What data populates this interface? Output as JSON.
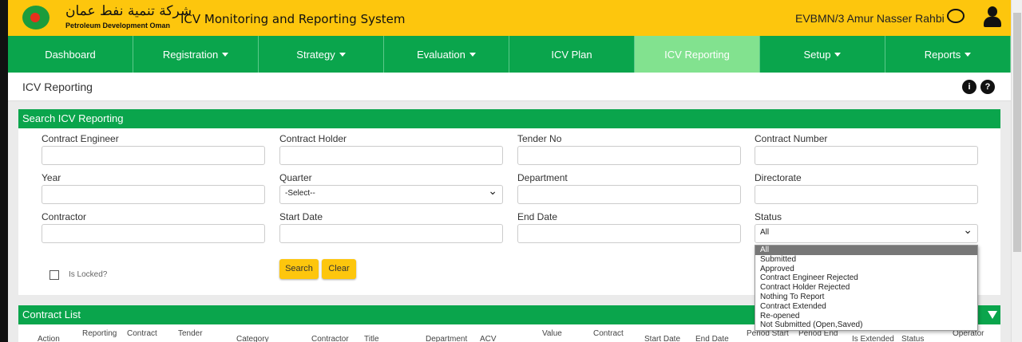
{
  "header": {
    "logo_arabic": "شركة تنمية نفط عمان",
    "logo_text": "Petroleum Development Oman",
    "title": "ICV Monitoring and Reporting System",
    "user": "EVBMN/3 Amur Nasser Rahbi"
  },
  "nav": [
    {
      "label": "Dashboard",
      "caret": false
    },
    {
      "label": "Registration",
      "caret": true
    },
    {
      "label": "Strategy",
      "caret": true
    },
    {
      "label": "Evaluation",
      "caret": true
    },
    {
      "label": "ICV Plan",
      "caret": false
    },
    {
      "label": "ICV Reporting",
      "caret": false,
      "active": true
    },
    {
      "label": "Setup",
      "caret": true
    },
    {
      "label": "Reports",
      "caret": true
    }
  ],
  "page": {
    "title": "ICV Reporting",
    "info_icon": "i",
    "help_icon": "?"
  },
  "search": {
    "title": "Search ICV Reporting",
    "fields": {
      "contract_engineer": "Contract Engineer",
      "contract_holder": "Contract Holder",
      "tender_no": "Tender No",
      "contract_number": "Contract Number",
      "year": "Year",
      "quarter": "Quarter",
      "department": "Department",
      "directorate": "Directorate",
      "contractor": "Contractor",
      "start_date": "Start Date",
      "end_date": "End Date",
      "status": "Status"
    },
    "quarter_value": "-Select--",
    "status_value": "All",
    "is_locked": "Is Locked?",
    "search_btn": "Search",
    "clear_btn": "Clear",
    "status_options": [
      "All",
      "Submitted",
      "Approved",
      "Contract Engineer Rejected",
      "Contract Holder Rejected",
      "Nothing To Report",
      "Contract Extended",
      "Re-opened",
      "Not Submitted (Open,Saved)"
    ]
  },
  "contract_list": {
    "title": "Contract List",
    "columns": [
      "Action",
      "Reporting",
      "Contract",
      "Tender",
      "Category",
      "Contractor",
      "Title",
      "Department",
      "ACV",
      "Value",
      "Contract",
      "Start Date",
      "End Date",
      "Period Start",
      "Period End",
      "Is Extended",
      "Status",
      "Operator"
    ]
  },
  "colors": {
    "yellow": "#fdc60d",
    "green": "#0aa54c",
    "active_nav": "#82e28f"
  }
}
